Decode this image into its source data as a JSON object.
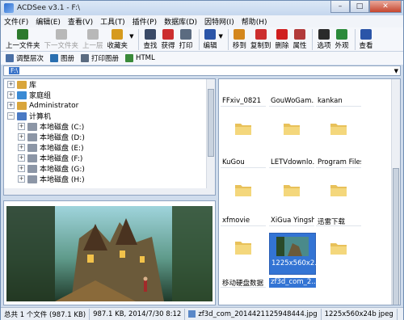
{
  "window": {
    "title": "ACDSee v3.1 - F:\\",
    "min": "–",
    "max": "□",
    "close": "✕"
  },
  "menu": [
    "文件(F)",
    "编辑(E)",
    "查看(V)",
    "工具(T)",
    "插件(P)",
    "数据库(D)",
    "因特网(I)",
    "帮助(H)"
  ],
  "toolbar": [
    {
      "label": "上一文件夹",
      "icon": "folder-up-icon",
      "color": "#2d7a2d",
      "disabled": false
    },
    {
      "label": "下一文件夹",
      "icon": "folder-next-icon",
      "color": "#b8b8b8",
      "disabled": true
    },
    {
      "label": "上一层",
      "icon": "up-level-icon",
      "color": "#b8b8b8",
      "disabled": true
    },
    {
      "label": "收藏夹",
      "icon": "favorites-icon",
      "color": "#d69a1d",
      "disabled": false
    },
    {
      "label": "查找",
      "icon": "binoculars-icon",
      "color": "#3a4a66",
      "disabled": false
    },
    {
      "label": "获得",
      "icon": "acquire-icon",
      "color": "#cc2e2e",
      "disabled": false
    },
    {
      "label": "打印",
      "icon": "print-icon",
      "color": "#5b6b80",
      "disabled": false
    },
    {
      "label": "编辑",
      "icon": "edit-icon",
      "color": "#2b55a8",
      "disabled": false
    },
    {
      "label": "移到",
      "icon": "move-icon",
      "color": "#d4871c",
      "disabled": false
    },
    {
      "label": "复制到",
      "icon": "copy-icon",
      "color": "#cc2e2e",
      "disabled": false
    },
    {
      "label": "删除",
      "icon": "delete-icon",
      "color": "#d01f1f",
      "disabled": false
    },
    {
      "label": "属性",
      "icon": "properties-icon",
      "color": "#b23a3a",
      "disabled": false
    },
    {
      "label": "选项",
      "icon": "options-icon",
      "color": "#2a2a2a",
      "disabled": false
    },
    {
      "label": "外观",
      "icon": "appearance-icon",
      "color": "#2b8a3a",
      "disabled": false
    },
    {
      "label": "查看",
      "icon": "view-icon",
      "color": "#2b55a8",
      "disabled": false
    }
  ],
  "toolbar2": [
    {
      "label": "调整层次",
      "icon": "layers-icon",
      "color": "#4a6fa5"
    },
    {
      "label": "图册",
      "icon": "album-icon",
      "color": "#2a6fb0"
    },
    {
      "label": "打印图册",
      "icon": "print-album-icon",
      "color": "#5b6b80"
    },
    {
      "label": "HTML",
      "icon": "html-icon",
      "color": "#3a8a3a"
    }
  ],
  "address": {
    "value": "F:\\"
  },
  "tree": [
    {
      "label": "库",
      "indent": 0,
      "expander": "+",
      "icon": "library-icon",
      "color": "#d9a53a"
    },
    {
      "label": "家庭组",
      "indent": 0,
      "expander": "+",
      "icon": "homegroup-icon",
      "color": "#3a8ad4"
    },
    {
      "label": "Administrator",
      "indent": 0,
      "expander": "+",
      "icon": "user-folder-icon",
      "color": "#d9a53a"
    },
    {
      "label": "计算机",
      "indent": 0,
      "expander": "−",
      "icon": "computer-icon",
      "color": "#4a7ac4"
    },
    {
      "label": "本地磁盘 (C:)",
      "indent": 1,
      "expander": "+",
      "icon": "drive-icon",
      "color": "#8c96a6"
    },
    {
      "label": "本地磁盘 (D:)",
      "indent": 1,
      "expander": "+",
      "icon": "drive-icon",
      "color": "#8c96a6"
    },
    {
      "label": "本地磁盘 (E:)",
      "indent": 1,
      "expander": "+",
      "icon": "drive-icon",
      "color": "#8c96a6"
    },
    {
      "label": "本地磁盘 (F:)",
      "indent": 1,
      "expander": "+",
      "icon": "drive-icon",
      "color": "#8c96a6"
    },
    {
      "label": "本地磁盘 (G:)",
      "indent": 1,
      "expander": "+",
      "icon": "drive-icon",
      "color": "#8c96a6"
    },
    {
      "label": "本地磁盘 (H:)",
      "indent": 1,
      "expander": "+",
      "icon": "drive-icon",
      "color": "#8c96a6"
    }
  ],
  "files": [
    {
      "name": "FFxiv_0821",
      "type": "folder"
    },
    {
      "name": "GouWoGam...",
      "type": "folder"
    },
    {
      "name": "kankan",
      "type": "folder"
    },
    {
      "name": "KuGou",
      "type": "folder"
    },
    {
      "name": "LETVdownlo...",
      "type": "folder"
    },
    {
      "name": "Program Files",
      "type": "folder"
    },
    {
      "name": "xfmovie",
      "type": "folder"
    },
    {
      "name": "XiGua Yingshi",
      "type": "folder"
    },
    {
      "name": "迅雷下载",
      "type": "folder"
    },
    {
      "name": "移动硬盘数据",
      "type": "folder"
    },
    {
      "name": "zf3d_com_2...",
      "type": "image",
      "caption": "1225x560x2..."
    }
  ],
  "status": {
    "summary": "总共 1 个文件 (987.1 KB)",
    "detail": "987.1 KB, 2014/7/30 8:12",
    "filename": "zf3d_com_2014421125948444.jpg",
    "dims": "1225x560x24b jpeg"
  }
}
